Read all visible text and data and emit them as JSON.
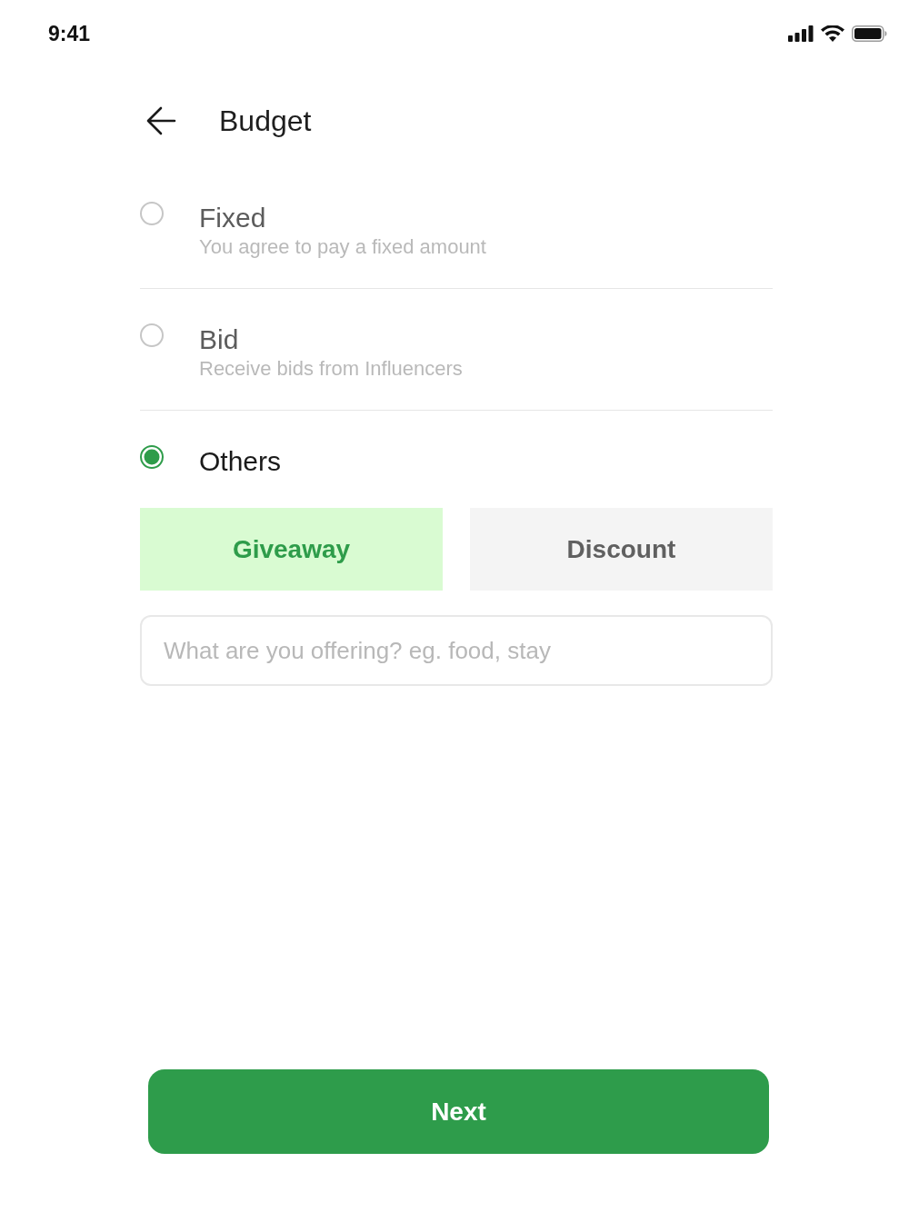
{
  "status_bar": {
    "time": "9:41"
  },
  "header": {
    "title": "Budget"
  },
  "options": [
    {
      "title": "Fixed",
      "subtitle": "You agree to pay a fixed amount",
      "selected": false
    },
    {
      "title": "Bid",
      "subtitle": "Receive bids from Influencers",
      "selected": false
    },
    {
      "title": "Others",
      "selected": true
    }
  ],
  "offer_types": [
    {
      "label": "Giveaway",
      "selected": true
    },
    {
      "label": "Discount",
      "selected": false
    }
  ],
  "offer_field": {
    "placeholder": "What are you offering? eg. food, stay"
  },
  "next_button": {
    "label": "Next"
  }
}
